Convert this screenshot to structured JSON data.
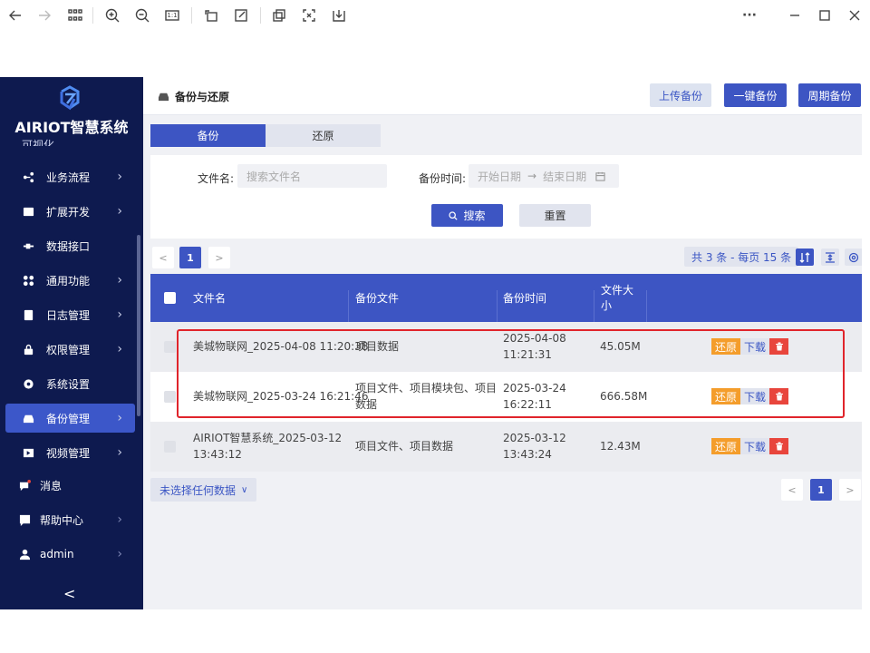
{
  "viewer_toolbar": {
    "icons": [
      "back-icon",
      "forward-icon",
      "grid-icon",
      "zoom-in-icon",
      "zoom-out-icon",
      "actual-size-icon",
      "rotate-icon",
      "edit-icon",
      "crop-icon",
      "fullscreen-icon",
      "download-icon"
    ],
    "actual_size_label": "1:1",
    "window_controls": [
      "more-icon",
      "minimize-icon",
      "maximize-icon",
      "close-icon"
    ]
  },
  "sidebar": {
    "logo_text": "AIRIOT智慧系统",
    "cut_item": "可视化",
    "items": [
      {
        "label": "业务流程",
        "icon": "flow-icon",
        "arrow": true
      },
      {
        "label": "扩展开发",
        "icon": "extend-icon",
        "arrow": true
      },
      {
        "label": "数据接口",
        "icon": "plug-icon",
        "arrow": false
      },
      {
        "label": "通用功能",
        "icon": "apps-icon",
        "arrow": true
      },
      {
        "label": "日志管理",
        "icon": "log-icon",
        "arrow": true
      },
      {
        "label": "权限管理",
        "icon": "lock-icon",
        "arrow": true
      },
      {
        "label": "系统设置",
        "icon": "gear-icon",
        "arrow": false
      },
      {
        "label": "备份管理",
        "icon": "drive-icon",
        "arrow": true,
        "active": true
      },
      {
        "label": "视频管理",
        "icon": "video-icon",
        "arrow": true
      }
    ],
    "bottom_items": [
      {
        "label": "消息",
        "icon": "message-icon"
      },
      {
        "label": "帮助中心",
        "icon": "help-icon"
      },
      {
        "label": "admin",
        "icon": "user-icon"
      }
    ],
    "collapse": "<"
  },
  "header": {
    "title": "备份与还原",
    "upload_backup": "上传备份",
    "one_click_backup": "一键备份",
    "periodic_backup": "周期备份"
  },
  "tabs": [
    {
      "label": "备份",
      "active": true
    },
    {
      "label": "还原",
      "active": false
    }
  ],
  "filter": {
    "file_name_label": "文件名:",
    "file_name_placeholder": "搜索文件名",
    "backup_time_label": "备份时间:",
    "start_date_placeholder": "开始日期",
    "arrow": "→",
    "end_date_placeholder": "结束日期",
    "search_button": "搜索",
    "reset_button": "重置"
  },
  "pagination": {
    "prev": "<",
    "page": "1",
    "next": ">",
    "summary": "共 3 条 - 每页 15 条"
  },
  "table": {
    "columns": [
      "文件名",
      "备份文件",
      "备份时间",
      "文件大小"
    ],
    "rows": [
      {
        "file_name": "美城物联网_2025-04-08 11:20:38",
        "backup_files": "项目数据",
        "time_line1": "2025-04-08",
        "time_line2": "11:21:31",
        "size": "45.05M"
      },
      {
        "file_name": "美城物联网_2025-03-24 16:21:46",
        "backup_files_line1": "项目文件、项目模块包、项目",
        "backup_files_line2": "数据",
        "time_line1": "2025-03-24",
        "time_line2": "16:22:11",
        "size": "666.58M"
      },
      {
        "file_name_line1": "AIRIOT智慧系统_2025-03-12",
        "file_name_line2": "13:43:12",
        "backup_files": "项目文件、项目数据",
        "time_line1": "2025-03-12",
        "time_line2": "13:43:24",
        "size": "12.43M"
      }
    ],
    "actions": {
      "restore": "还原",
      "download": "下载"
    }
  },
  "bulk": {
    "selection_label": "未选择任何数据",
    "chevron": "∨"
  },
  "colors": {
    "sidebar_bg": "#0e1a4f",
    "primary": "#3d55c3",
    "restore": "#f49d2b",
    "delete": "#e8453c",
    "highlight": "#e0242b"
  }
}
